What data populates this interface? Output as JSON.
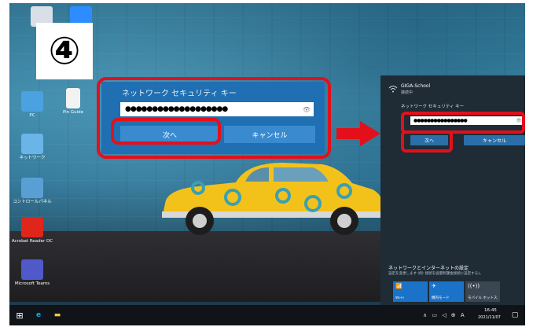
{
  "step_marker": "④",
  "desktop_icons": [
    {
      "label": "",
      "icon": "recycle-bin-icon",
      "color": "#d9dfe6"
    },
    {
      "label": "",
      "icon": "zoom-icon",
      "color": "#2d8cff"
    },
    {
      "label": "PC",
      "icon": "pc-icon",
      "color": "#4aa3e0"
    },
    {
      "label": "Pin Guide",
      "icon": "document-icon",
      "color": "#f2f2f2"
    },
    {
      "label": "ネットワーク",
      "icon": "network-icon",
      "color": "#6ab4e8"
    },
    {
      "label": "コントロールパネル",
      "icon": "control-panel-icon",
      "color": "#5a9fd4"
    },
    {
      "label": "Acrobat Reader DC",
      "icon": "acrobat-icon",
      "color": "#e0251b"
    },
    {
      "label": "Microsoft Teams",
      "icon": "teams-icon",
      "color": "#5059c9"
    }
  ],
  "zoomed_dialog": {
    "title": "ネットワーク セキュリティ キー",
    "password_mask": "●●●●●●●●●●●●●●●●●●●",
    "eye_glyph": "👁",
    "next_label": "次へ",
    "cancel_label": "キャンセル"
  },
  "flyout": {
    "network_name": "GIGA-School",
    "network_status": "接続中",
    "key_prompt": "ネットワーク セキュリティ キー",
    "password_mask": "●●●●●●●●●●●●●●●●",
    "eye_glyph": "👁",
    "next_label": "次へ",
    "cancel_label": "キャンセル",
    "settings_link": "ネットワークとインターネットの設定",
    "settings_sub": "設定を変更します (例: 接続を従量制課金接続に設定する)。",
    "quick_actions": [
      {
        "label": "Wi-Fi",
        "glyph": "📶",
        "color": "#1a73c8"
      },
      {
        "label": "機内モード",
        "glyph": "✈",
        "color": "#1a73c8"
      },
      {
        "label": "モバイル ホットスポット",
        "glyph": "((•))",
        "color": "#3a4652"
      }
    ]
  },
  "taskbar": {
    "start_glyph": "⊞",
    "edge_glyph": "e",
    "explorer_glyph": "▬",
    "tray_glyphs": "∧ ▭ ◁ ⊕ A",
    "time": "16:45",
    "date": "2021/11/07",
    "notif_glyph": "▢"
  },
  "arrow_color": "#e3101c",
  "highlight_color": "#e3101c"
}
